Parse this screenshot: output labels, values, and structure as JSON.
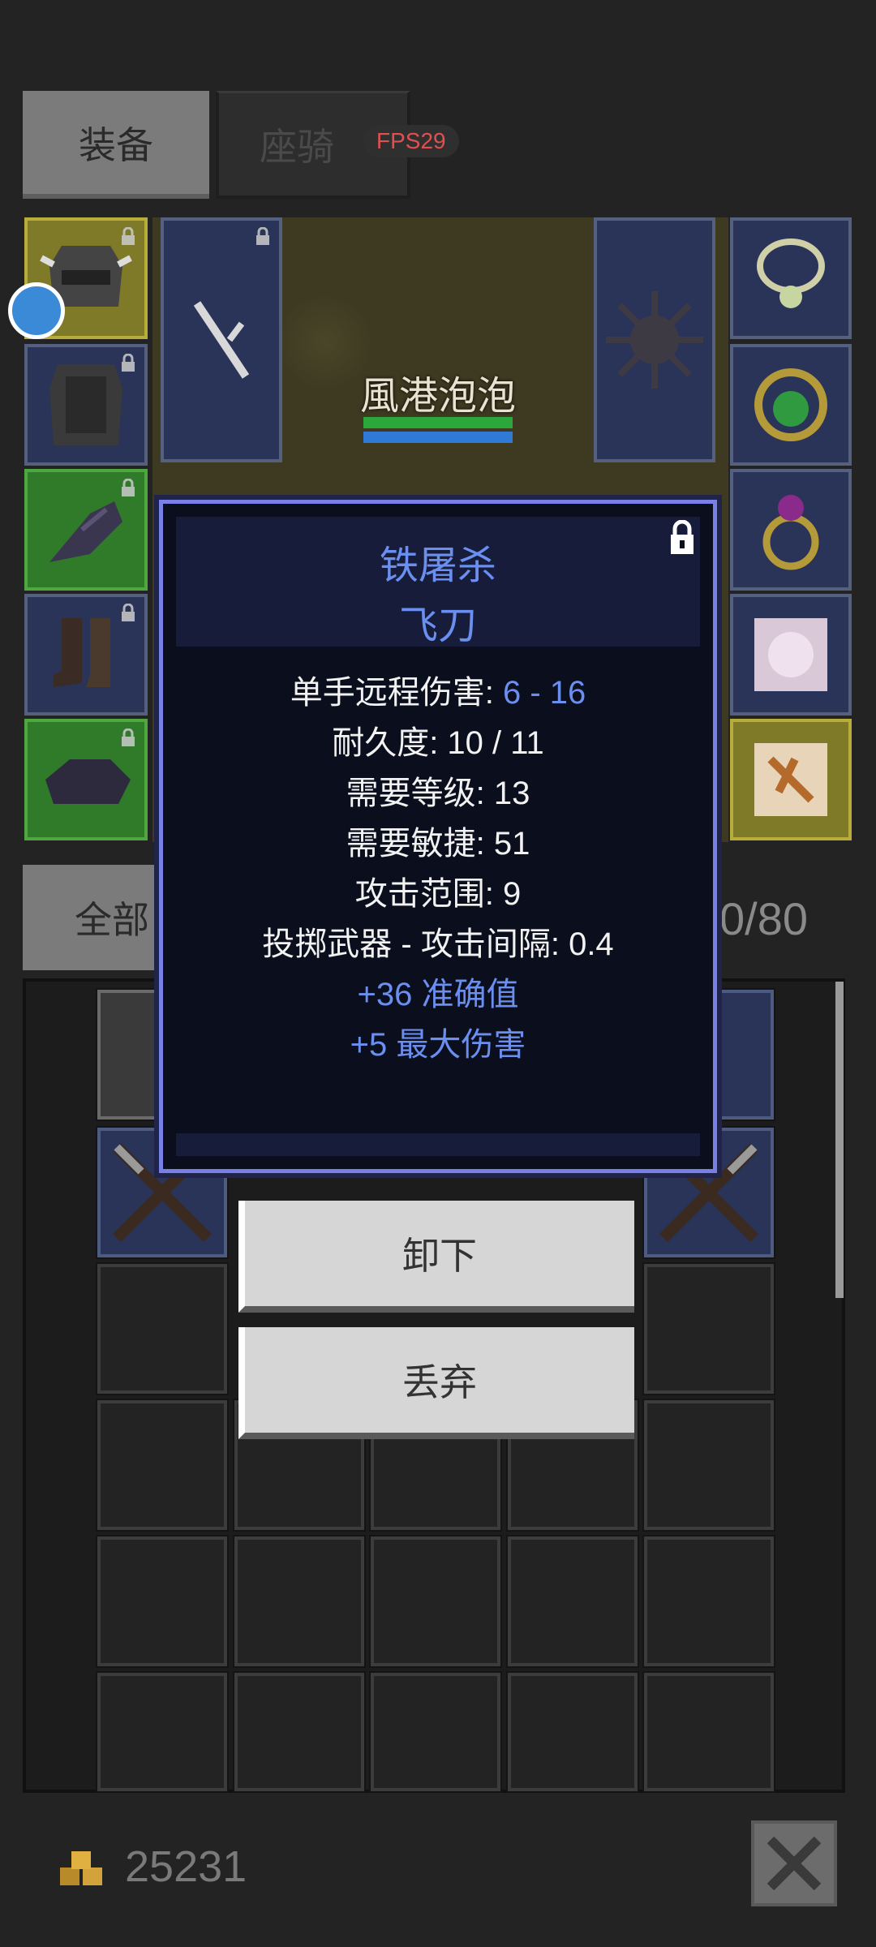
{
  "tabs": {
    "equipment": "装备",
    "mount": "座骑",
    "fps": "FPS29"
  },
  "character": {
    "name": "風港泡泡",
    "hp_fraction": 1.0,
    "mp_fraction": 1.0
  },
  "colors": {
    "accent_blue": "#6b8ff0",
    "slot_blue": "#2a3358",
    "slot_green": "#2f7b2a",
    "slot_yellow": "#7e7a27",
    "fps_red": "#e05050"
  },
  "equipment_slots": [
    {
      "slot": "helmet",
      "icon": "helmet-icon",
      "rarity": "yellow",
      "locked": true
    },
    {
      "slot": "armor",
      "icon": "armor-icon",
      "rarity": "blue",
      "locked": true
    },
    {
      "slot": "gloves",
      "icon": "gloves-icon",
      "rarity": "green",
      "locked": true
    },
    {
      "slot": "boots",
      "icon": "boots-icon",
      "rarity": "blue",
      "locked": true
    },
    {
      "slot": "cloak",
      "icon": "cloak-icon",
      "rarity": "green",
      "locked": true
    },
    {
      "slot": "weapon",
      "icon": "throwing-knife-icon",
      "rarity": "blue",
      "locked": true
    },
    {
      "slot": "offhand",
      "icon": "spiked-ball-icon",
      "rarity": "blue",
      "locked": false
    },
    {
      "slot": "necklace",
      "icon": "necklace-icon",
      "rarity": "blue",
      "locked": false
    },
    {
      "slot": "ring1",
      "icon": "emerald-ring-icon",
      "rarity": "blue",
      "locked": false
    },
    {
      "slot": "ring2",
      "icon": "ruby-ring-icon",
      "rarity": "blue",
      "locked": false
    },
    {
      "slot": "pet1",
      "icon": "pet-portrait-icon",
      "rarity": "blue",
      "locked": false
    },
    {
      "slot": "pet2",
      "icon": "pet-portrait-icon",
      "rarity": "yellow",
      "locked": false
    }
  ],
  "inventory": {
    "filter_label": "全部",
    "capacity": "0/80"
  },
  "tooltip": {
    "item_name": "铁屠杀",
    "item_type": "飞刀",
    "damage_label": "单手远程伤害: ",
    "damage_value": "6 - 16",
    "durability": "耐久度: 10 / 11",
    "req_level": "需要等级: 13",
    "req_dex": "需要敏捷: 51",
    "range": "攻击范围: 9",
    "attack_interval": "投掷武器 - 攻击间隔: 0.4",
    "bonus1": "+36 准确值",
    "bonus2": "+5 最大伤害"
  },
  "actions": {
    "unequip": "卸下",
    "drop": "丢弃"
  },
  "footer": {
    "gold": "25231"
  }
}
